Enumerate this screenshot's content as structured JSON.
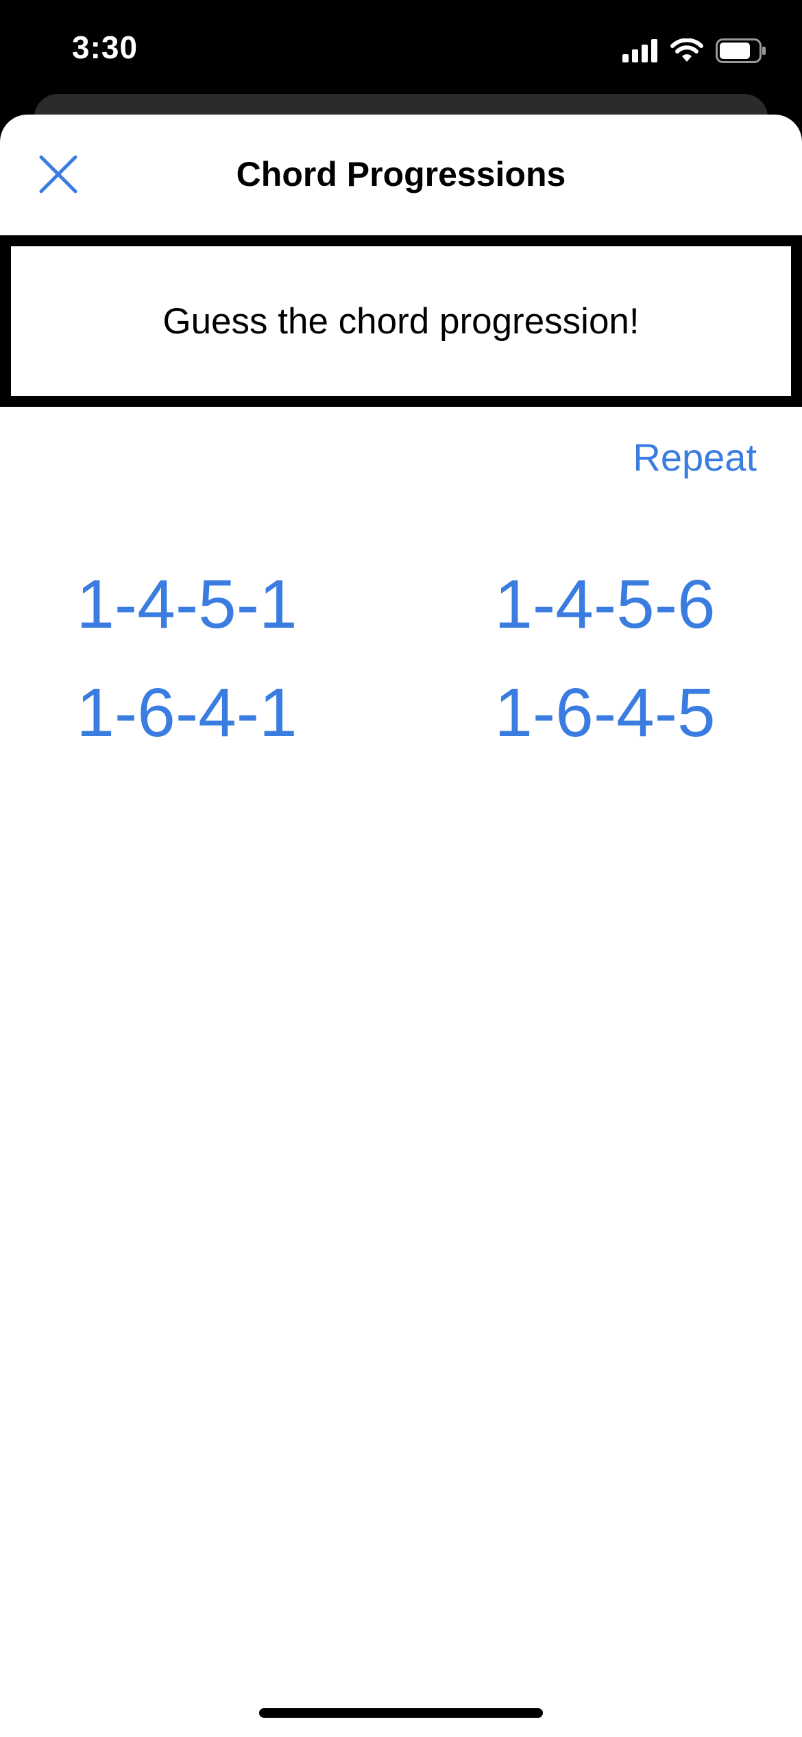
{
  "status_bar": {
    "time": "3:30",
    "icons": [
      "cellular-signal-icon",
      "wifi-icon",
      "battery-icon"
    ]
  },
  "nav": {
    "title": "Chord Progressions",
    "close_icon": "close-icon"
  },
  "prompt": {
    "text": "Guess the chord progression!"
  },
  "repeat_label": "Repeat",
  "answers": [
    "1-4-5-1",
    "1-4-5-6",
    "1-6-4-1",
    "1-6-4-5"
  ],
  "colors": {
    "accent": "#3a7ce0",
    "text": "#000000",
    "background": "#ffffff"
  }
}
